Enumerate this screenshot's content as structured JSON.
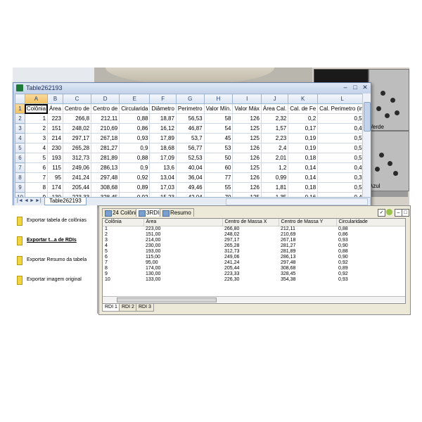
{
  "excel": {
    "window_title": "Table262193",
    "column_headers": [
      "A",
      "B",
      "C",
      "D",
      "E",
      "F",
      "G",
      "H",
      "I",
      "J",
      "K",
      "L",
      "M"
    ],
    "rows": [
      {
        "row": "1",
        "cells": [
          "Colônia",
          "Área",
          "Centro de",
          "Centro de",
          "Circularida",
          "Diâmetro",
          "Perimetro",
          "Valor Mín.",
          "Valor Máx",
          "Área Cal.",
          "Cal. de Fe",
          "Cal. Perimetro (in)",
          ""
        ]
      },
      {
        "row": "2",
        "cells": [
          "1",
          "223",
          "266,8",
          "212,11",
          "0,88",
          "18,87",
          "56,53",
          "58",
          "126",
          "2,32",
          "0,2",
          "0,59",
          ""
        ]
      },
      {
        "row": "3",
        "cells": [
          "2",
          "151",
          "248,02",
          "210,69",
          "0,86",
          "16,12",
          "46,87",
          "54",
          "125",
          "1,57",
          "0,17",
          "0,49",
          ""
        ]
      },
      {
        "row": "4",
        "cells": [
          "3",
          "214",
          "297,17",
          "267,18",
          "0,93",
          "17,89",
          "53,7",
          "45",
          "125",
          "2,23",
          "0,19",
          "0,56",
          ""
        ]
      },
      {
        "row": "5",
        "cells": [
          "4",
          "230",
          "265,28",
          "281,27",
          "0,9",
          "18,68",
          "56,77",
          "53",
          "126",
          "2,4",
          "0,19",
          "0,59",
          ""
        ]
      },
      {
        "row": "6",
        "cells": [
          "5",
          "193",
          "312,73",
          "281,89",
          "0,88",
          "17,09",
          "52,53",
          "50",
          "126",
          "2,01",
          "0,18",
          "0,55",
          ""
        ]
      },
      {
        "row": "7",
        "cells": [
          "6",
          "115",
          "249,06",
          "286,13",
          "0,9",
          "13,6",
          "40,04",
          "60",
          "125",
          "1,2",
          "0,14",
          "0,42",
          ""
        ]
      },
      {
        "row": "8",
        "cells": [
          "7",
          "95",
          "241,24",
          "297,48",
          "0,92",
          "13,04",
          "36,04",
          "77",
          "126",
          "0,99",
          "0,14",
          "0,38",
          ""
        ]
      },
      {
        "row": "9",
        "cells": [
          "8",
          "174",
          "205,44",
          "308,68",
          "0,89",
          "17,03",
          "49,46",
          "55",
          "126",
          "1,81",
          "0,18",
          "0,52",
          ""
        ]
      },
      {
        "row": "10",
        "cells": [
          "9",
          "130",
          "223,33",
          "328,45",
          "0,92",
          "15,23",
          "42,04",
          "70",
          "125",
          "1,35",
          "0,16",
          "0,44",
          ""
        ]
      },
      {
        "row": "11",
        "cells": [
          "10",
          "133",
          "226,3",
          "354,38",
          "0,93",
          "14,56",
          "42,28",
          "53",
          "126",
          "1,39",
          "0,15",
          "0,44",
          ""
        ]
      }
    ],
    "sheet_tab": "Table262193",
    "sheet_nav": [
      "|◄",
      "◄",
      "►",
      "►|"
    ]
  },
  "background": {
    "thumb_label_1": "Verde",
    "thumb_label_2": "Azul"
  },
  "export_panel": {
    "items": [
      {
        "label": "Exportar tabela de colônias",
        "active": false
      },
      {
        "label": "Exportar t...a de RDIs",
        "active": true
      },
      {
        "label": "Exportar Resumo da tabela",
        "active": false
      },
      {
        "label": "Exportar imagem original",
        "active": false
      }
    ]
  },
  "results": {
    "tabs": [
      "24 Colônias",
      "3RDIs",
      "Resumo"
    ],
    "columns": [
      "Colônia",
      "Área",
      "Centro de Massa X",
      "Centro de Massa Y",
      "Circularidade"
    ],
    "rows": [
      [
        "1",
        "223,00",
        "266,80",
        "212,11",
        "0,88"
      ],
      [
        "2",
        "151,00",
        "248,02",
        "210,69",
        "0,86"
      ],
      [
        "3",
        "214,00",
        "297,17",
        "267,18",
        "0,93"
      ],
      [
        "4",
        "230,00",
        "265,28",
        "281,27",
        "0,90"
      ],
      [
        "5",
        "193,00",
        "312,73",
        "281,89",
        "0,88"
      ],
      [
        "6",
        "115,00",
        "249,06",
        "286,13",
        "0,90"
      ],
      [
        "7",
        "95,00",
        "241,24",
        "297,48",
        "0,92"
      ],
      [
        "8",
        "174,00",
        "205,44",
        "308,68",
        "0,89"
      ],
      [
        "9",
        "130,00",
        "223,33",
        "328,45",
        "0,92"
      ],
      [
        "10",
        "133,00",
        "226,30",
        "354,38",
        "0,93"
      ]
    ],
    "bottom_tabs": [
      "RDI 1",
      "RDI 2",
      "RDI 3"
    ]
  }
}
